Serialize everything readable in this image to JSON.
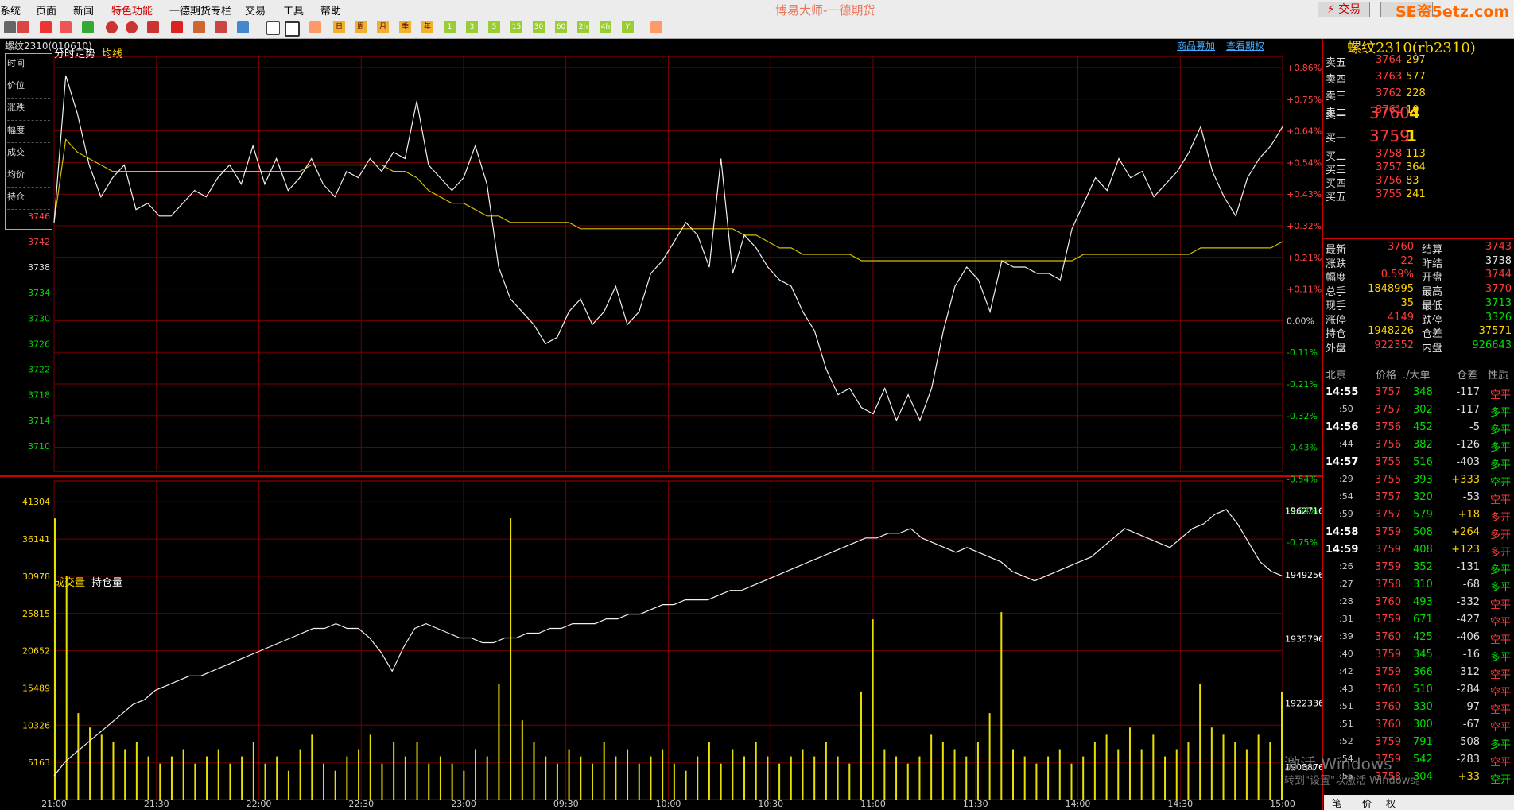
{
  "menu": {
    "items": [
      "系统",
      "页面",
      "新闻",
      "特色功能",
      "一德期货专栏",
      "交易",
      "工具",
      "帮助"
    ],
    "app_title": "博易大师-一德期货",
    "trade_button": "⚡ 交易",
    "watermark": "SE资5etz.com"
  },
  "toolbar": {
    "period_buttons": [
      "日",
      "周",
      "月",
      "季",
      "年",
      "1",
      "3",
      "5",
      "15",
      "30",
      "60",
      "2h",
      "4h",
      "Y"
    ]
  },
  "chart": {
    "contract": "螺纹2310(010610)",
    "tab_label": "分时走势",
    "avg_label": "均线",
    "link_products": "商品募加",
    "link_options": "查看期权",
    "vol_label": "成交量",
    "oi_label": "持仓量",
    "side_labels": [
      "时间",
      "价位",
      "涨跌",
      "幅度",
      "成交",
      "均价",
      "持仓"
    ],
    "x_ticks": [
      "21:00",
      "21:30",
      "22:00",
      "22:30",
      "23:00",
      "09:30",
      "10:00",
      "10:30",
      "11:00",
      "11:30",
      "14:00",
      "14:30",
      "15:00"
    ]
  },
  "chart_data": {
    "type": "line",
    "price_ticks": [
      "3746",
      "3742",
      "3738",
      "3734",
      "3730",
      "3726",
      "3722",
      "3718",
      "3714",
      "3710"
    ],
    "pct_ticks": [
      "+0.86%",
      "+0.75%",
      "+0.64%",
      "+0.54%",
      "+0.43%",
      "+0.32%",
      "+0.21%",
      "+0.11%",
      "0.00%",
      "-0.11%",
      "-0.21%",
      "-0.32%",
      "-0.43%",
      "-0.54%",
      "-0.64%",
      "-0.75%"
    ],
    "vol_ticks": [
      "41304",
      "36141",
      "30978",
      "25815",
      "20652",
      "15489",
      "10326",
      "5163"
    ],
    "oi_ticks": [
      "1962716",
      "1949256",
      "1935796",
      "1922336",
      "1908876"
    ],
    "ylim": [
      3706,
      3771
    ],
    "prev_settle": 3738,
    "series": [
      {
        "values": [
          3745,
          3768,
          3762,
          3754,
          3749,
          3752,
          3754,
          3747,
          3748,
          3746,
          3746,
          3748,
          3750,
          3749,
          3752,
          3754,
          3751,
          3757,
          3751,
          3755,
          3750,
          3752,
          3755,
          3751,
          3749,
          3753,
          3752,
          3755,
          3753,
          3756,
          3755,
          3764,
          3754,
          3752,
          3750,
          3752,
          3757,
          3751,
          3738,
          3733,
          3731,
          3729,
          3726,
          3727,
          3731,
          3733,
          3729,
          3731,
          3735,
          3729,
          3731,
          3737,
          3739,
          3742,
          3745,
          3743,
          3738,
          3755,
          3737,
          3743,
          3741,
          3738,
          3736,
          3735,
          3731,
          3728,
          3722,
          3718,
          3719,
          3716,
          3715,
          3719,
          3714,
          3718,
          3714,
          3719,
          3728,
          3735,
          3738,
          3736,
          3731,
          3739,
          3738,
          3738,
          3737,
          3737,
          3736,
          3744,
          3748,
          3752,
          3750,
          3755,
          3752,
          3753,
          3749,
          3751,
          3753,
          3756,
          3760,
          3753,
          3749,
          3746,
          3752,
          3755,
          3757,
          3760
        ]
      },
      {
        "values": [
          3745,
          3758,
          3756,
          3755,
          3754,
          3753,
          3753,
          3753,
          3753,
          3753,
          3753,
          3753,
          3753,
          3753,
          3753,
          3753,
          3753,
          3753,
          3753,
          3753,
          3753,
          3753,
          3754,
          3754,
          3754,
          3754,
          3754,
          3754,
          3754,
          3753,
          3753,
          3752,
          3750,
          3749,
          3748,
          3748,
          3747,
          3746,
          3746,
          3745,
          3745,
          3745,
          3745,
          3745,
          3745,
          3744,
          3744,
          3744,
          3744,
          3744,
          3744,
          3744,
          3744,
          3744,
          3744,
          3744,
          3744,
          3744,
          3744,
          3743,
          3743,
          3742,
          3741,
          3741,
          3740,
          3740,
          3740,
          3740,
          3740,
          3739,
          3739,
          3739,
          3739,
          3739,
          3739,
          3739,
          3739,
          3739,
          3739,
          3739,
          3739,
          3739,
          3739,
          3739,
          3739,
          3739,
          3739,
          3739,
          3740,
          3740,
          3740,
          3740,
          3740,
          3740,
          3740,
          3740,
          3740,
          3740,
          3741,
          3741,
          3741,
          3741,
          3741,
          3741,
          3741,
          3742
        ]
      }
    ],
    "volume": [
      39000,
      31000,
      12000,
      10000,
      9000,
      8000,
      7000,
      8000,
      6000,
      5000,
      6000,
      7000,
      5000,
      6000,
      7000,
      5000,
      6000,
      8000,
      5000,
      6000,
      4000,
      7000,
      9000,
      5000,
      4000,
      6000,
      7000,
      9000,
      5000,
      8000,
      6000,
      8000,
      5000,
      6000,
      5000,
      4000,
      7000,
      6000,
      16000,
      39000,
      11000,
      8000,
      6000,
      5000,
      7000,
      6000,
      5000,
      8000,
      6000,
      7000,
      5000,
      6000,
      7000,
      5000,
      4000,
      6000,
      8000,
      5000,
      7000,
      6000,
      8000,
      6000,
      5000,
      6000,
      7000,
      6000,
      8000,
      6000,
      5000,
      15000,
      25000,
      7000,
      6000,
      5000,
      6000,
      9000,
      8000,
      7000,
      6000,
      8000,
      12000,
      26000,
      7000,
      6000,
      5000,
      6000,
      7000,
      5000,
      6000,
      8000,
      9000,
      7000,
      10000,
      7000,
      9000,
      6000,
      7000,
      8000,
      16000,
      10000,
      9000,
      8000,
      7000,
      9000,
      8000,
      15000
    ],
    "oi_values": [
      1907000,
      1910000,
      1912000,
      1914000,
      1916000,
      1918000,
      1920000,
      1922000,
      1923000,
      1925000,
      1926000,
      1927000,
      1928000,
      1928000,
      1929000,
      1930000,
      1931000,
      1932000,
      1933000,
      1934000,
      1935000,
      1936000,
      1937000,
      1938000,
      1938000,
      1939000,
      1938000,
      1938000,
      1936000,
      1933000,
      1929000,
      1934000,
      1938000,
      1939000,
      1938000,
      1937000,
      1936000,
      1936000,
      1935000,
      1935000,
      1936000,
      1936000,
      1937000,
      1937000,
      1938000,
      1938000,
      1939000,
      1939000,
      1939000,
      1940000,
      1940000,
      1941000,
      1941000,
      1942000,
      1943000,
      1943000,
      1944000,
      1944000,
      1944000,
      1945000,
      1946000,
      1946000,
      1947000,
      1948000,
      1949000,
      1950000,
      1951000,
      1952000,
      1953000,
      1954000,
      1955000,
      1956000,
      1957000,
      1957000,
      1958000,
      1958000,
      1959000,
      1957000,
      1956000,
      1955000,
      1954000,
      1955000,
      1954000,
      1953000,
      1952000,
      1950000,
      1949000,
      1948000,
      1949000,
      1950000,
      1951000,
      1952000,
      1953000,
      1955000,
      1957000,
      1959000,
      1958000,
      1957000,
      1956000,
      1955000,
      1957000,
      1959000,
      1960000,
      1962000,
      1963000,
      1960000,
      1956000,
      1952000,
      1950000,
      1949000
    ]
  },
  "quote": {
    "title": "螺纹2310(rb2310)",
    "asks": [
      {
        "label": "卖五",
        "price": "3764",
        "vol": "297"
      },
      {
        "label": "卖四",
        "price": "3763",
        "vol": "577"
      },
      {
        "label": "卖三",
        "price": "3762",
        "vol": "228"
      },
      {
        "label": "卖二",
        "price": "3761",
        "vol": "10"
      },
      {
        "label": "卖一",
        "price": "3760",
        "vol": "4"
      }
    ],
    "bids": [
      {
        "label": "买一",
        "price": "3759",
        "vol": "1"
      },
      {
        "label": "买二",
        "price": "3758",
        "vol": "113"
      },
      {
        "label": "买三",
        "price": "3757",
        "vol": "364"
      },
      {
        "label": "买四",
        "price": "3756",
        "vol": "83"
      },
      {
        "label": "买五",
        "price": "3755",
        "vol": "241"
      }
    ],
    "stats": [
      {
        "l1": "最新",
        "v1": "3760",
        "c1": "red",
        "l2": "结算",
        "v2": "3743",
        "c2": "red"
      },
      {
        "l1": "涨跌",
        "v1": "22",
        "c1": "red",
        "l2": "昨结",
        "v2": "3738",
        "c2": "wht"
      },
      {
        "l1": "幅度",
        "v1": "0.59%",
        "c1": "red",
        "l2": "开盘",
        "v2": "3744",
        "c2": "red"
      },
      {
        "l1": "总手",
        "v1": "1848995",
        "c1": "yel",
        "l2": "最高",
        "v2": "3770",
        "c2": "red"
      },
      {
        "l1": "现手",
        "v1": "35",
        "c1": "yel",
        "l2": "最低",
        "v2": "3713",
        "c2": "grn"
      },
      {
        "l1": "涨停",
        "v1": "4149",
        "c1": "red",
        "l2": "跌停",
        "v2": "3326",
        "c2": "grn"
      },
      {
        "l1": "持仓",
        "v1": "1948226",
        "c1": "yel",
        "l2": "仓差",
        "v2": "37571",
        "c2": "yel"
      },
      {
        "l1": "外盘",
        "v1": "922352",
        "c1": "red",
        "l2": "内盘",
        "v2": "926643",
        "c2": "grn"
      }
    ],
    "tick_header": [
      "北京",
      "价格",
      "./大单",
      "仓差",
      "性质"
    ],
    "ticks": [
      {
        "t": "14:55",
        "p": "3757",
        "v": "348",
        "d": "-117",
        "n": "空平",
        "bold": true,
        "pc": "red",
        "nc": "red"
      },
      {
        "t": ":50",
        "p": "3757",
        "v": "302",
        "d": "-117",
        "n": "多平",
        "pc": "red",
        "nc": "grn"
      },
      {
        "t": "14:56",
        "p": "3756",
        "v": "452",
        "d": "-5",
        "n": "多平",
        "bold": true,
        "pc": "red",
        "nc": "grn"
      },
      {
        "t": ":44",
        "p": "3756",
        "v": "382",
        "d": "-126",
        "n": "多平",
        "pc": "red",
        "nc": "grn"
      },
      {
        "t": "14:57",
        "p": "3755",
        "v": "516",
        "d": "-403",
        "n": "多平",
        "bold": true,
        "pc": "red",
        "nc": "grn"
      },
      {
        "t": ":29",
        "p": "3755",
        "v": "393",
        "d": "+333",
        "n": "空开",
        "pc": "red",
        "nc": "grn"
      },
      {
        "t": ":54",
        "p": "3757",
        "v": "320",
        "d": "-53",
        "n": "空平",
        "pc": "red",
        "nc": "red"
      },
      {
        "t": ":59",
        "p": "3757",
        "v": "579",
        "d": "+18",
        "n": "多开",
        "pc": "red",
        "nc": "red"
      },
      {
        "t": "14:58",
        "p": "3759",
        "v": "508",
        "d": "+264",
        "n": "多开",
        "bold": true,
        "pc": "red",
        "nc": "red"
      },
      {
        "t": "14:59",
        "p": "3759",
        "v": "408",
        "d": "+123",
        "n": "多开",
        "bold": true,
        "pc": "red",
        "nc": "red"
      },
      {
        "t": ":26",
        "p": "3759",
        "v": "352",
        "d": "-131",
        "n": "多平",
        "pc": "red",
        "nc": "grn"
      },
      {
        "t": ":27",
        "p": "3758",
        "v": "310",
        "d": "-68",
        "n": "多平",
        "pc": "red",
        "nc": "grn"
      },
      {
        "t": ":28",
        "p": "3760",
        "v": "493",
        "d": "-332",
        "n": "空平",
        "pc": "red",
        "nc": "red"
      },
      {
        "t": ":31",
        "p": "3759",
        "v": "671",
        "d": "-427",
        "n": "空平",
        "pc": "red",
        "nc": "red"
      },
      {
        "t": ":39",
        "p": "3760",
        "v": "425",
        "d": "-406",
        "n": "空平",
        "pc": "red",
        "nc": "red"
      },
      {
        "t": ":40",
        "p": "3759",
        "v": "345",
        "d": "-16",
        "n": "多平",
        "pc": "red",
        "nc": "grn"
      },
      {
        "t": ":42",
        "p": "3759",
        "v": "366",
        "d": "-312",
        "n": "空平",
        "pc": "red",
        "nc": "red"
      },
      {
        "t": ":43",
        "p": "3760",
        "v": "510",
        "d": "-284",
        "n": "空平",
        "pc": "red",
        "nc": "red"
      },
      {
        "t": ":51",
        "p": "3760",
        "v": "330",
        "d": "-97",
        "n": "空平",
        "pc": "red",
        "nc": "red"
      },
      {
        "t": ":51",
        "p": "3760",
        "v": "300",
        "d": "-67",
        "n": "空平",
        "pc": "red",
        "nc": "red"
      },
      {
        "t": ":52",
        "p": "3759",
        "v": "791",
        "d": "-508",
        "n": "多平",
        "pc": "red",
        "nc": "grn"
      },
      {
        "t": ":54",
        "p": "3759",
        "v": "542",
        "d": "-283",
        "n": "空平",
        "pc": "red",
        "nc": "red"
      },
      {
        "t": ":55",
        "p": "3758",
        "v": "304",
        "d": "+33",
        "n": "空开",
        "pc": "red",
        "nc": "grn"
      }
    ],
    "status_tabs": [
      "笔",
      "价",
      "权"
    ]
  },
  "windows_notice": {
    "line1": "激活 Windows",
    "line2": "转到\"设置\"以激活 Windows。"
  }
}
